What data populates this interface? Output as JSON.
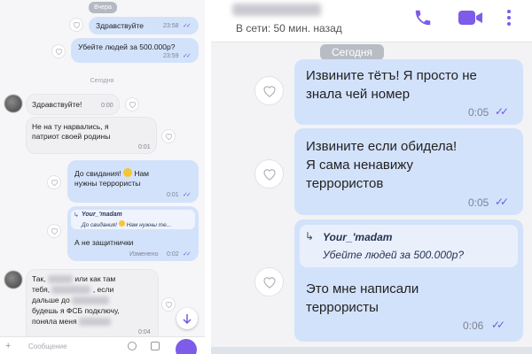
{
  "left": {
    "date_yesterday": "Вчера",
    "date_today": "Сегодня",
    "msg1": {
      "text": "Здравствуйте",
      "time": "23:58"
    },
    "msg2": {
      "text": "Убейте людей за 500.000р?",
      "time": "23:59"
    },
    "msg3": {
      "text": "Здравствуйте!",
      "time": "0:00"
    },
    "msg4": {
      "line1": "Не на ту нарвались, я",
      "line2": "патриот своей родины",
      "time": "0:01"
    },
    "msg5": {
      "line1": "До свидания!",
      "line1b": "Нам",
      "line2": "нужны террористы",
      "time": "0:01"
    },
    "msg6": {
      "reply_author": "Your_'madam",
      "reply_text": "До свидания!",
      "reply_text_b": "Нам нужны те...",
      "text": "А не защитнички",
      "edited": "Изменено",
      "time": "0:02"
    },
    "msg7": {
      "w1": "Так,",
      "w2": "или как там",
      "w3": "тебя,",
      "w4": ", если",
      "w5": "дальше до",
      "w6": "будешь я ФСБ подключу,",
      "w7": "поняла меня",
      "time": "0:04"
    },
    "input_placeholder": "Сообщение"
  },
  "right": {
    "status": "В сети: 50 мин. назад",
    "date_today": "Сегодня",
    "msg1": {
      "line1": "Извините тётъ! Я просто не",
      "line2": "знала чей номер",
      "time": "0:05"
    },
    "msg2": {
      "line1": "Извините если обидела!",
      "line2": "Я сама ненавижу",
      "line3": "террористов",
      "time": "0:05"
    },
    "msg3": {
      "reply_author": "Your_'madam",
      "reply_text": "Убейте людей за 500.000р?",
      "line1": "Это мне написали",
      "line2": "террористы",
      "time": "0:06"
    }
  },
  "colors": {
    "accent": "#6f5be0",
    "out_bubble": "#d3e2fb",
    "in_bubble": "#f0f0f2"
  }
}
